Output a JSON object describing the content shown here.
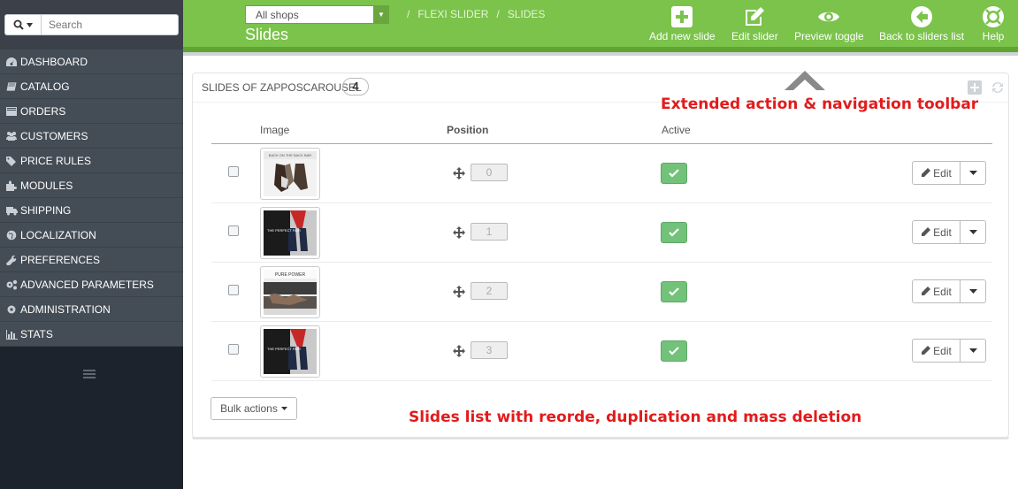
{
  "sidebar": {
    "search_placeholder": "Search",
    "items": [
      {
        "label": "DASHBOARD",
        "icon": "dashboard-icon"
      },
      {
        "label": "CATALOG",
        "icon": "book-icon"
      },
      {
        "label": "ORDERS",
        "icon": "credit-card-icon"
      },
      {
        "label": "CUSTOMERS",
        "icon": "users-icon"
      },
      {
        "label": "PRICE RULES",
        "icon": "tags-icon"
      },
      {
        "label": "MODULES",
        "icon": "puzzle-icon"
      },
      {
        "label": "SHIPPING",
        "icon": "truck-icon"
      },
      {
        "label": "LOCALIZATION",
        "icon": "globe-icon"
      },
      {
        "label": "PREFERENCES",
        "icon": "wrench-icon"
      },
      {
        "label": "ADVANCED PARAMETERS",
        "icon": "cogs-icon"
      },
      {
        "label": "ADMINISTRATION",
        "icon": "cog-icon"
      },
      {
        "label": "STATS",
        "icon": "bar-chart-icon"
      }
    ]
  },
  "header": {
    "shop_select": "All shops",
    "breadcrumb": [
      "FLEXI SLIDER",
      "SLIDES"
    ],
    "title": "Slides",
    "toolbar": [
      {
        "label": "Add new slide",
        "icon": "plus-square-icon"
      },
      {
        "label": "Edit slider",
        "icon": "edit-icon"
      },
      {
        "label": "Preview toggle",
        "icon": "eye-icon"
      },
      {
        "label": "Back to sliders list",
        "icon": "arrow-left-circle-icon"
      },
      {
        "label": "Help",
        "icon": "life-ring-icon"
      }
    ]
  },
  "panel": {
    "title": "SLIDES OF ZAPPOSCAROUSEL",
    "count": "4",
    "columns": {
      "image": "Image",
      "position": "Position",
      "active": "Active"
    },
    "rows": [
      {
        "position": "0",
        "active": true,
        "edit_label": "Edit",
        "thumb_caption": "BACK ON THE BACK BAR"
      },
      {
        "position": "1",
        "active": true,
        "edit_label": "Edit",
        "thumb_caption": "THE PERFECT PAIR"
      },
      {
        "position": "2",
        "active": true,
        "edit_label": "Edit",
        "thumb_caption": "PURE POWER"
      },
      {
        "position": "3",
        "active": true,
        "edit_label": "Edit",
        "thumb_caption": "THE PERFECT PAIR"
      }
    ],
    "bulk_label": "Bulk actions"
  },
  "annotations": {
    "toolbar_note": "Extended action & navigation toolbar",
    "list_note": "Slides list with reorde, duplication and  mass deletion"
  },
  "colors": {
    "header_green": "#7bc34b",
    "sidebar_dark": "#1d232c",
    "nav_bg": "#444c55",
    "active_green": "#72c279",
    "annotation_red": "#e21b1b"
  }
}
